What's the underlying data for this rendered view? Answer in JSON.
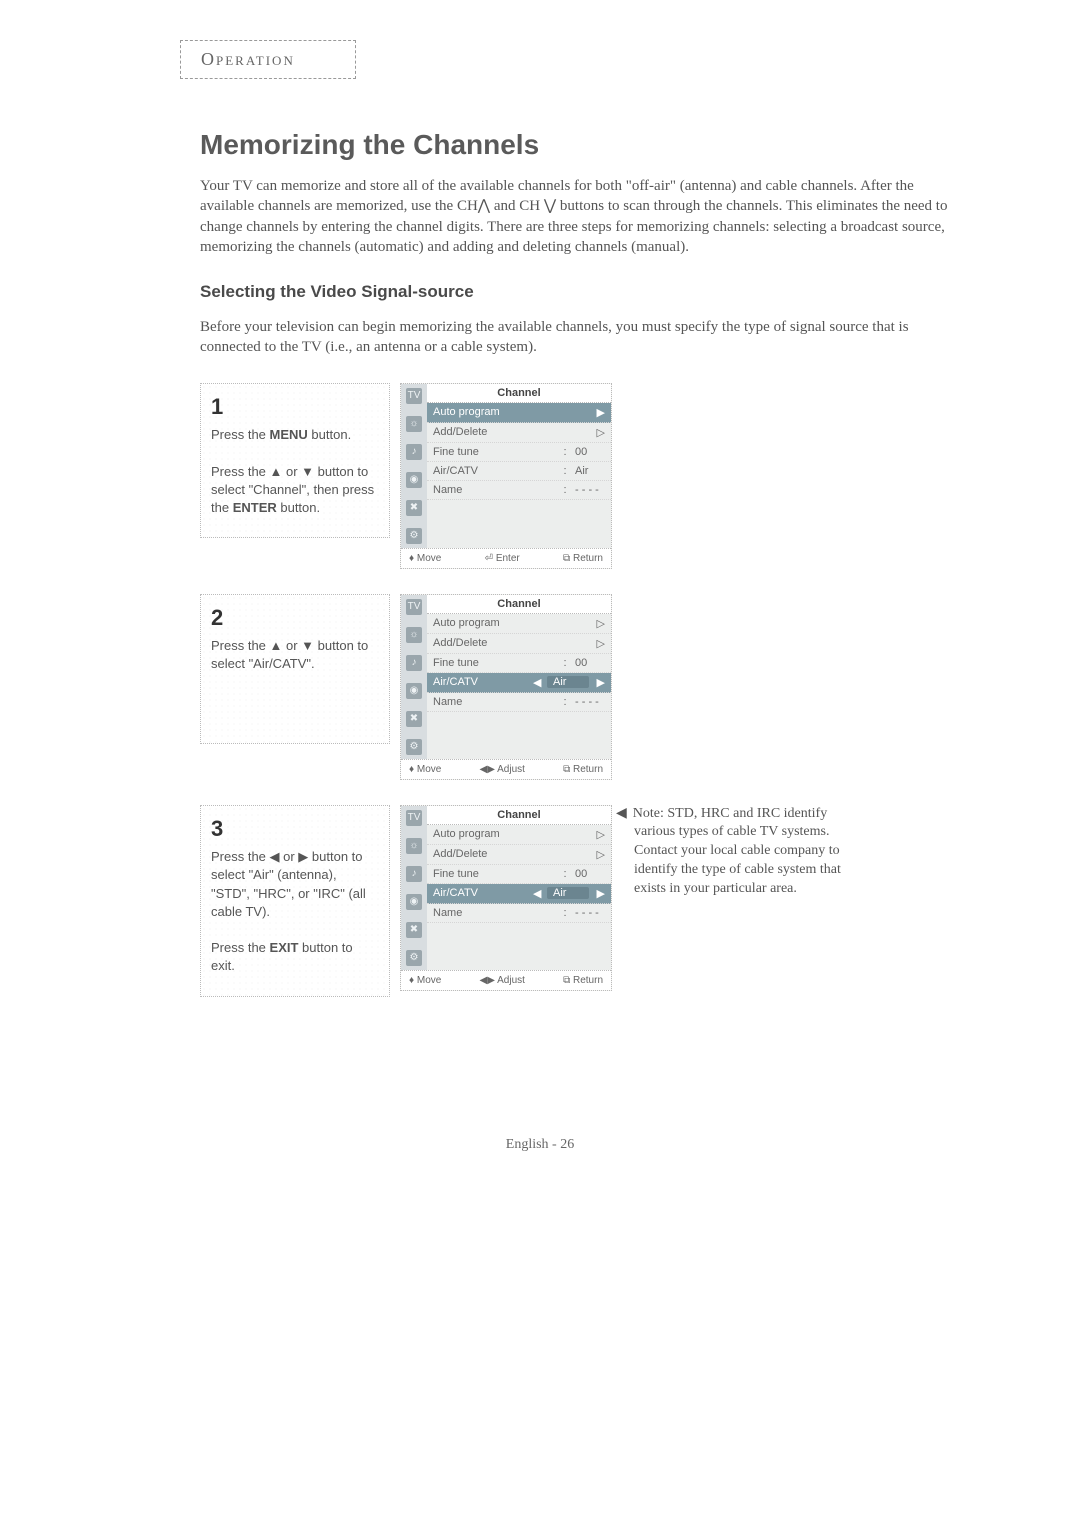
{
  "section_tab": "Operation",
  "title": "Memorizing the Channels",
  "intro": "Your TV can memorize and store all of the available channels for both \"off-air\" (antenna) and cable channels. After the available channels are memorized, use the CH⋀ and CH ⋁ buttons to scan through the channels. This eliminates the need to change channels by entering the channel digits. There are three steps for memorizing channels: selecting a broadcast source, memorizing the channels (automatic) and adding and deleting channels (manual).",
  "subhead": "Selecting the Video Signal-source",
  "subtext": "Before your television can begin memorizing the available channels, you must specify the type of signal source that is connected to the TV (i.e., an antenna or a cable system).",
  "steps": [
    {
      "num": "1",
      "html": "Press the <b>MENU</b> button.<br><br>Press the ▲ or ▼ button to select \"Channel\", then press the <b>ENTER</b> button."
    },
    {
      "num": "2",
      "html": "Press the ▲ or ▼ button to select \"Air/CATV\"."
    },
    {
      "num": "3",
      "html": "Press the ◀ or ▶ button to select \"Air\" (antenna), \"STD\", \"HRC\", or \"IRC\" (all cable TV).<br><br>Press the <b>EXIT</b> button to exit."
    }
  ],
  "osd_title": "Channel",
  "osd_tab": "TV",
  "menu": {
    "items": [
      "Auto program",
      "Add/Delete",
      "Fine tune",
      "Air/CATV",
      "Name"
    ],
    "fine_val": "00",
    "air_val": "Air",
    "name_val": "- - - -"
  },
  "footer": {
    "move": "Move",
    "enter": "Enter",
    "adjust": "Adjust",
    "ret": "Return"
  },
  "note": "Note: STD, HRC and IRC identify various types of cable TV systems. Contact your local cable company to identify the type of cable system that exists in your particular area.",
  "page_foot": "English - 26"
}
